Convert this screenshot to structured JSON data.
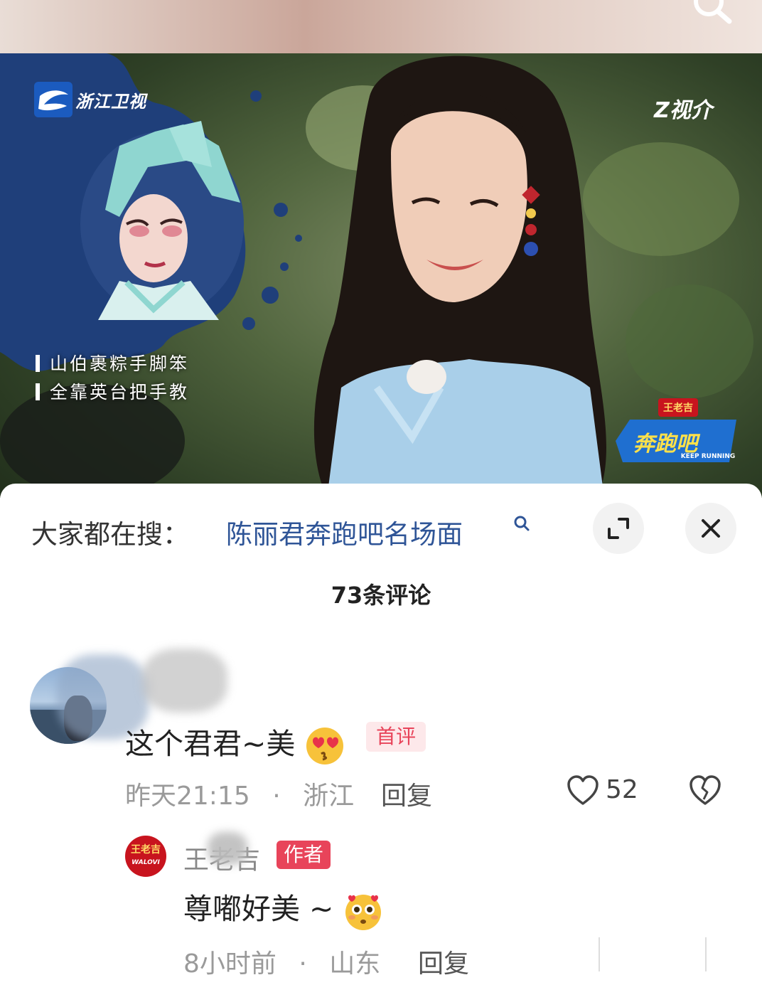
{
  "video": {
    "channel_logo": "浙江卫视",
    "platform_logo": "Z视介",
    "caption_line1": "山伯裹粽手脚笨",
    "caption_line2": "全靠英台把手教",
    "show_logo_sponsor": "王老吉",
    "show_logo_title": "奔跑吧",
    "show_logo_en": "KEEP RUNNING"
  },
  "search_bar": {
    "prefix": "大家都在搜：",
    "query": "陈丽君奔跑吧名场面",
    "icon": "search-icon"
  },
  "buttons": {
    "expand_icon": "expand-icon",
    "close_icon": "close-icon"
  },
  "comments": {
    "count_label": "73条评论",
    "items": [
      {
        "text": "这个君君~美",
        "emoji": "heart-eyes-kiss-emoji",
        "badge": "首评",
        "time": "昨天21:15",
        "separator": "·",
        "location": "浙江",
        "reply_label": "回复",
        "likes": "52"
      }
    ],
    "replies": [
      {
        "avatar_text_1": "王老吉",
        "avatar_text_2": "WALOVI",
        "name": "王老吉",
        "badge": "作者",
        "text": "尊嘟好美 ~",
        "emoji": "starstruck-emoji",
        "time": "8小时前",
        "separator": "·",
        "location": "山东",
        "reply_label": "回复"
      }
    ]
  },
  "colors": {
    "link_blue": "#2f5597",
    "badge_red": "#e8445a",
    "badge_pink_bg": "#fde8ea"
  }
}
